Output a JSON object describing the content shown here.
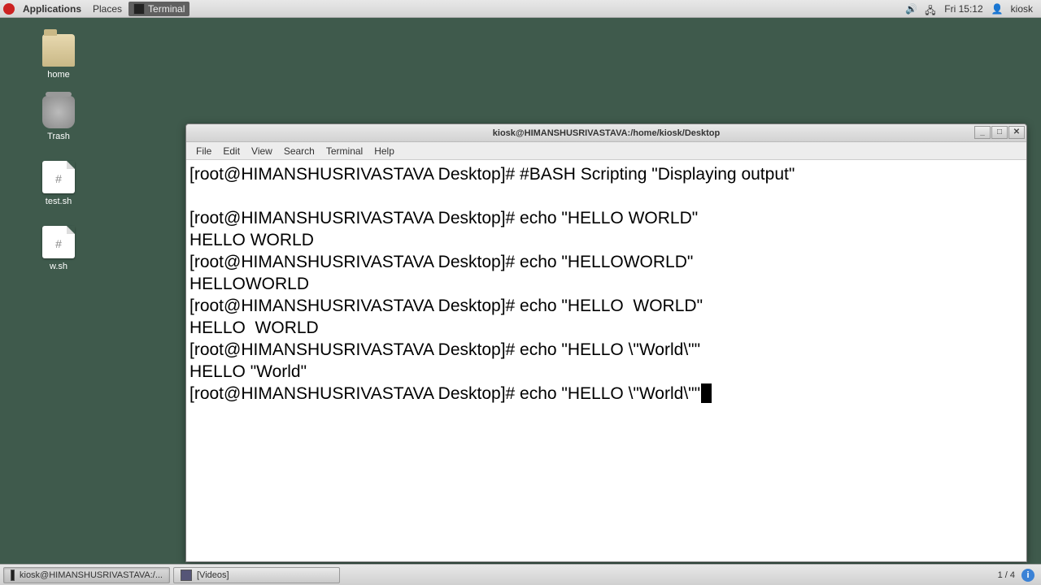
{
  "panel": {
    "applications": "Applications",
    "places": "Places",
    "active_app": "Terminal",
    "clock": "Fri 15:12",
    "user": "kiosk"
  },
  "desktop": {
    "home": "home",
    "trash": "Trash",
    "file1": "test.sh",
    "file2": "w.sh"
  },
  "window": {
    "title": "kiosk@HIMANSHUSRIVASTAVA:/home/kiosk/Desktop",
    "menu": {
      "file": "File",
      "edit": "Edit",
      "view": "View",
      "search": "Search",
      "terminal": "Terminal",
      "help": "Help"
    },
    "btn_min": "_",
    "btn_max": "□",
    "btn_close": "✕"
  },
  "terminal": {
    "prompt": "[root@HIMANSHUSRIVASTAVA Desktop]# ",
    "lines": {
      "l1": "[root@HIMANSHUSRIVASTAVA Desktop]# #BASH Scripting \"Displaying output\"",
      "l2": "",
      "l3": "[root@HIMANSHUSRIVASTAVA Desktop]# echo \"HELLO WORLD\"",
      "l4": "HELLO WORLD",
      "l5": "[root@HIMANSHUSRIVASTAVA Desktop]# echo \"HELLOWORLD\"",
      "l6": "HELLOWORLD",
      "l7": "[root@HIMANSHUSRIVASTAVA Desktop]# echo \"HELLO  WORLD\"",
      "l8": "HELLO  WORLD",
      "l9": "[root@HIMANSHUSRIVASTAVA Desktop]# echo \"HELLO \\\"World\\\"\"",
      "l10": "HELLO \"World\"",
      "l11": "[root@HIMANSHUSRIVASTAVA Desktop]# echo \"HELLO \\\"World\\\"\""
    }
  },
  "taskbar": {
    "task1": "kiosk@HIMANSHUSRIVASTAVA:/...",
    "task2": "[Videos]",
    "pager": "1 / 4"
  }
}
